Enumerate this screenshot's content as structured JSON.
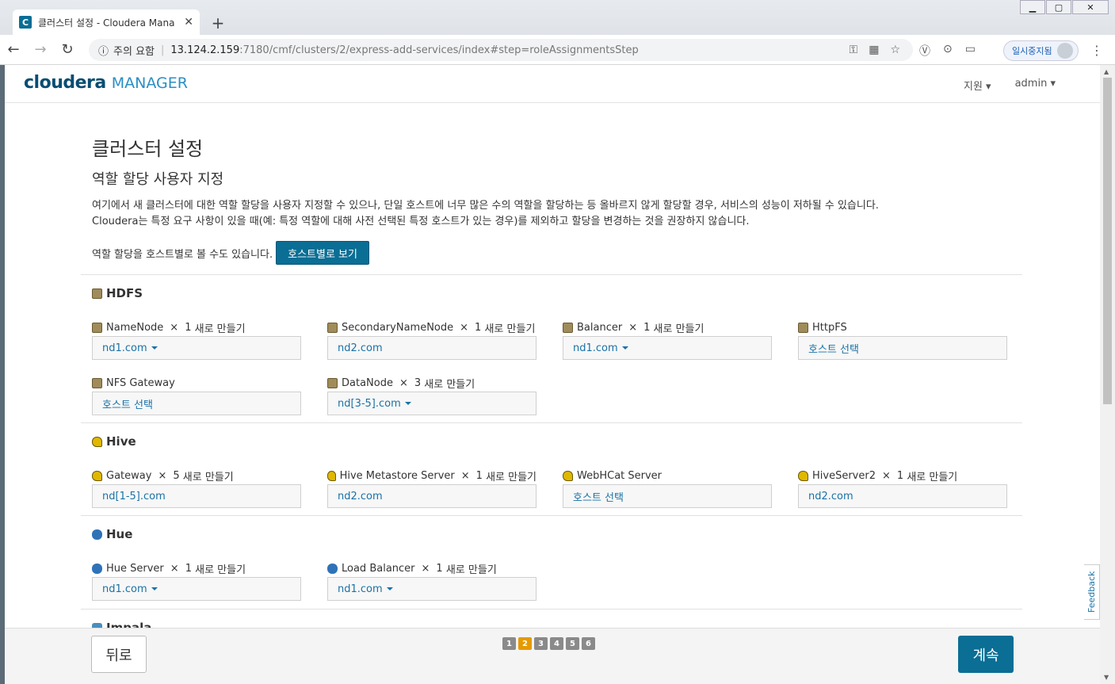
{
  "browser": {
    "tab_title": "클러스터 설정 - Cloudera Mana",
    "favicon_letter": "C",
    "security_label": "주의 요함",
    "url_host": "13.124.2.159",
    "url_path": ":7180/cmf/clusters/2/express-add-services/index#step=roleAssignmentsStep",
    "profile_label": "일시중지됨"
  },
  "header": {
    "logo_main": "cloudera",
    "logo_sub": "MANAGER",
    "support_label": "지원",
    "user_label": "admin"
  },
  "page": {
    "title": "클러스터 설정",
    "subtitle": "역할 할당 사용자 지정",
    "description_1": "여기에서 새 클러스터에 대한 역할 할당을 사용자 지정할 수 있으나, 단일 호스트에 너무 많은 수의 역할을 할당하는 등 올바르지 않게 할당할 경우, 서비스의 성능이 저하될 수 있습니다.",
    "description_2": "Cloudera는 특정 요구 사항이 있을 때(예: 특정 역할에 대해 사전 선택된 특정 호스트가 있는 경우)를 제외하고 할당을 변경하는 것을 권장하지 않습니다.",
    "view_by_host_text": "역할 할당을 호스트별로 볼 수도 있습니다.",
    "view_by_host_button": "호스트별로 보기"
  },
  "services": {
    "hdfs": {
      "name": "HDFS",
      "roles": [
        {
          "name": "NameNode",
          "count": "1",
          "suffix": "새로 만들기",
          "host": "nd1.com"
        },
        {
          "name": "SecondaryNameNode",
          "count": "1",
          "suffix": "새로 만들기",
          "host": "nd2.com"
        },
        {
          "name": "Balancer",
          "count": "1",
          "suffix": "새로 만들기",
          "host": "nd1.com"
        },
        {
          "name": "HttpFS",
          "host": "호스트 선택"
        },
        {
          "name": "NFS Gateway",
          "host": "호스트 선택"
        },
        {
          "name": "DataNode",
          "count": "3",
          "suffix": "새로 만들기",
          "host": "nd[3-5].com"
        }
      ]
    },
    "hive": {
      "name": "Hive",
      "roles": [
        {
          "name": "Gateway",
          "count": "5",
          "suffix": "새로 만들기",
          "host": "nd[1-5].com"
        },
        {
          "name": "Hive Metastore Server",
          "count": "1",
          "suffix": "새로 만들기",
          "host": "nd2.com"
        },
        {
          "name": "WebHCat Server",
          "host": "호스트 선택"
        },
        {
          "name": "HiveServer2",
          "count": "1",
          "suffix": "새로 만들기",
          "host": "nd2.com"
        }
      ]
    },
    "hue": {
      "name": "Hue",
      "roles": [
        {
          "name": "Hue Server",
          "count": "1",
          "suffix": "새로 만들기",
          "host": "nd1.com"
        },
        {
          "name": "Load Balancer",
          "count": "1",
          "suffix": "새로 만들기",
          "host": "nd1.com"
        }
      ]
    },
    "impala": {
      "name": "Impala"
    }
  },
  "footer": {
    "back_label": "뒤로",
    "next_label": "계속",
    "steps": [
      "1",
      "2",
      "3",
      "4",
      "5",
      "6"
    ],
    "active_step": "2"
  },
  "feedback_label": "Feedback",
  "colors": {
    "accent": "#0a6e95",
    "step_active": "#e69a00",
    "link": "#1a72a6"
  }
}
